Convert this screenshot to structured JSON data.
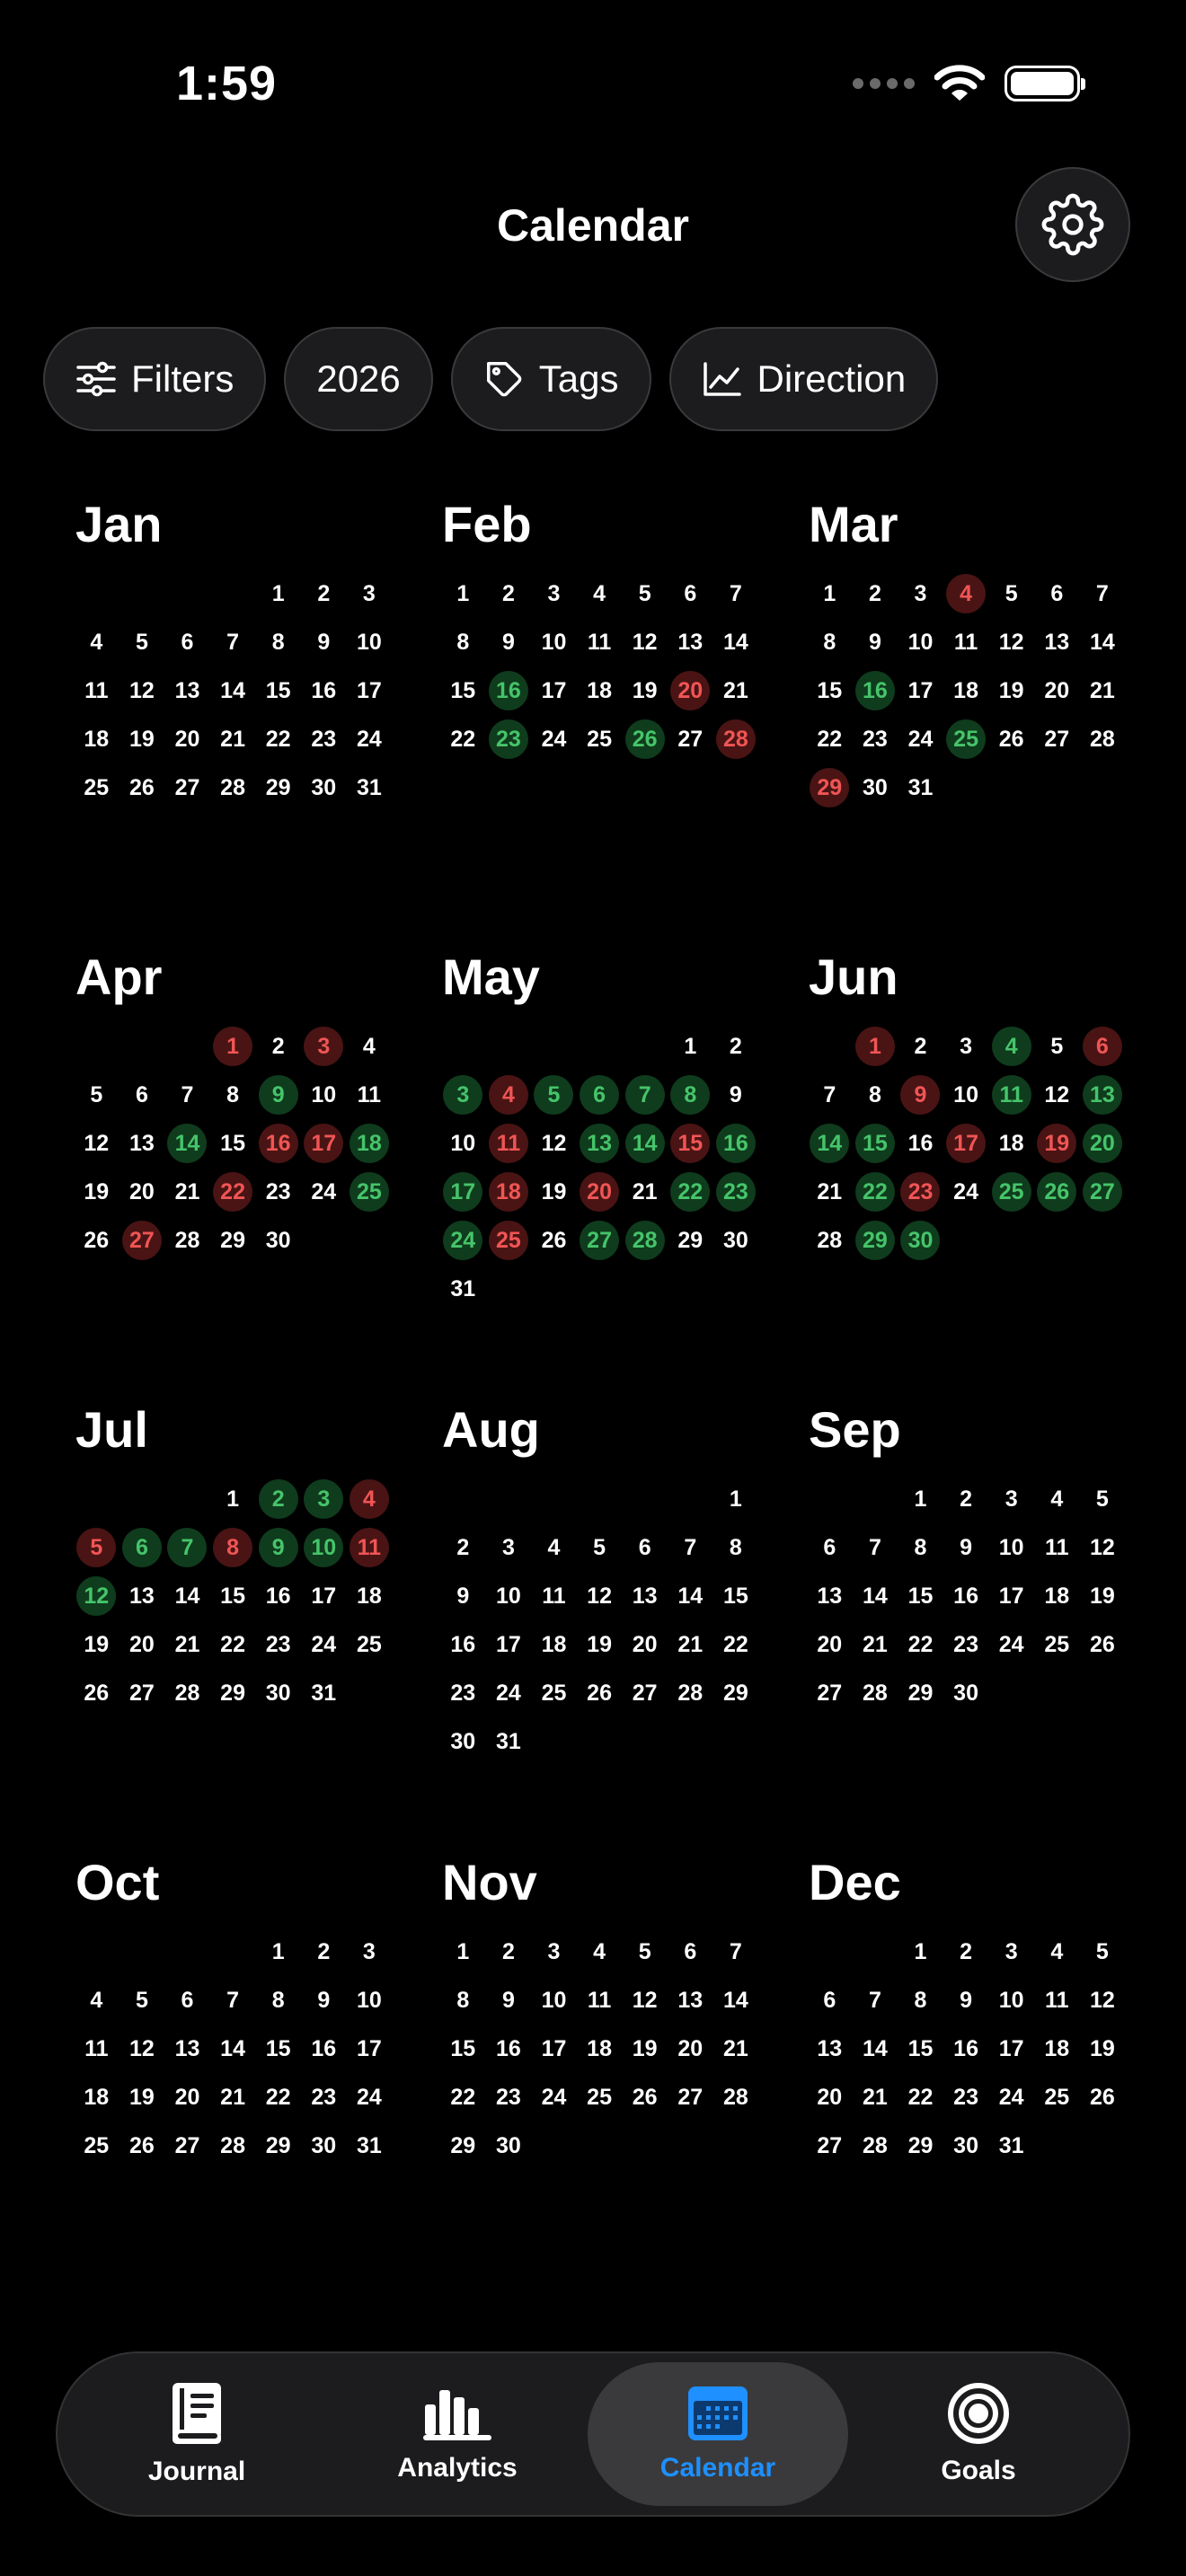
{
  "status_bar": {
    "time": "1:59"
  },
  "header": {
    "title": "Calendar"
  },
  "chips": [
    {
      "label": "Filters",
      "icon": "sliders-icon"
    },
    {
      "label": "2026",
      "icon": ""
    },
    {
      "label": "Tags",
      "icon": "tag-icon"
    },
    {
      "label": "Direction",
      "icon": "chart-line-icon"
    }
  ],
  "colors": {
    "green_bg": "#0f3c1d",
    "green_text": "#46c46a",
    "red_bg": "#4a1414",
    "red_text": "#f05555",
    "accent": "#1e90ff"
  },
  "months": [
    {
      "name": "Jan",
      "offset": 4,
      "days": 31,
      "green": [],
      "red": []
    },
    {
      "name": "Feb",
      "offset": 0,
      "days": 28,
      "green": [
        16,
        23,
        26
      ],
      "red": [
        20,
        28
      ]
    },
    {
      "name": "Mar",
      "offset": 0,
      "days": 31,
      "green": [
        16,
        25
      ],
      "red": [
        4,
        29
      ]
    },
    {
      "name": "Apr",
      "offset": 3,
      "days": 30,
      "green": [
        9,
        14,
        18,
        25
      ],
      "red": [
        1,
        3,
        16,
        17,
        22,
        27
      ]
    },
    {
      "name": "May",
      "offset": 5,
      "days": 31,
      "green": [
        3,
        5,
        6,
        7,
        8,
        13,
        14,
        16,
        17,
        22,
        23,
        24,
        27,
        28
      ],
      "red": [
        4,
        11,
        15,
        18,
        20,
        25
      ]
    },
    {
      "name": "Jun",
      "offset": 1,
      "days": 30,
      "green": [
        4,
        11,
        13,
        14,
        15,
        20,
        22,
        25,
        26,
        27,
        29,
        30
      ],
      "red": [
        1,
        6,
        9,
        17,
        19,
        23
      ]
    },
    {
      "name": "Jul",
      "offset": 3,
      "days": 31,
      "green": [
        2,
        3,
        6,
        7,
        9,
        10,
        12
      ],
      "red": [
        4,
        5,
        8,
        11
      ]
    },
    {
      "name": "Aug",
      "offset": 6,
      "days": 31,
      "green": [],
      "red": []
    },
    {
      "name": "Sep",
      "offset": 2,
      "days": 30,
      "green": [],
      "red": []
    },
    {
      "name": "Oct",
      "offset": 4,
      "days": 31,
      "green": [],
      "red": []
    },
    {
      "name": "Nov",
      "offset": 0,
      "days": 30,
      "green": [],
      "red": []
    },
    {
      "name": "Dec",
      "offset": 2,
      "days": 31,
      "green": [],
      "red": []
    }
  ],
  "tabs": [
    {
      "label": "Journal",
      "icon": "journal-icon",
      "active": false
    },
    {
      "label": "Analytics",
      "icon": "bar-chart-icon",
      "active": false
    },
    {
      "label": "Calendar",
      "icon": "calendar-icon",
      "active": true
    },
    {
      "label": "Goals",
      "icon": "target-icon",
      "active": false
    }
  ]
}
